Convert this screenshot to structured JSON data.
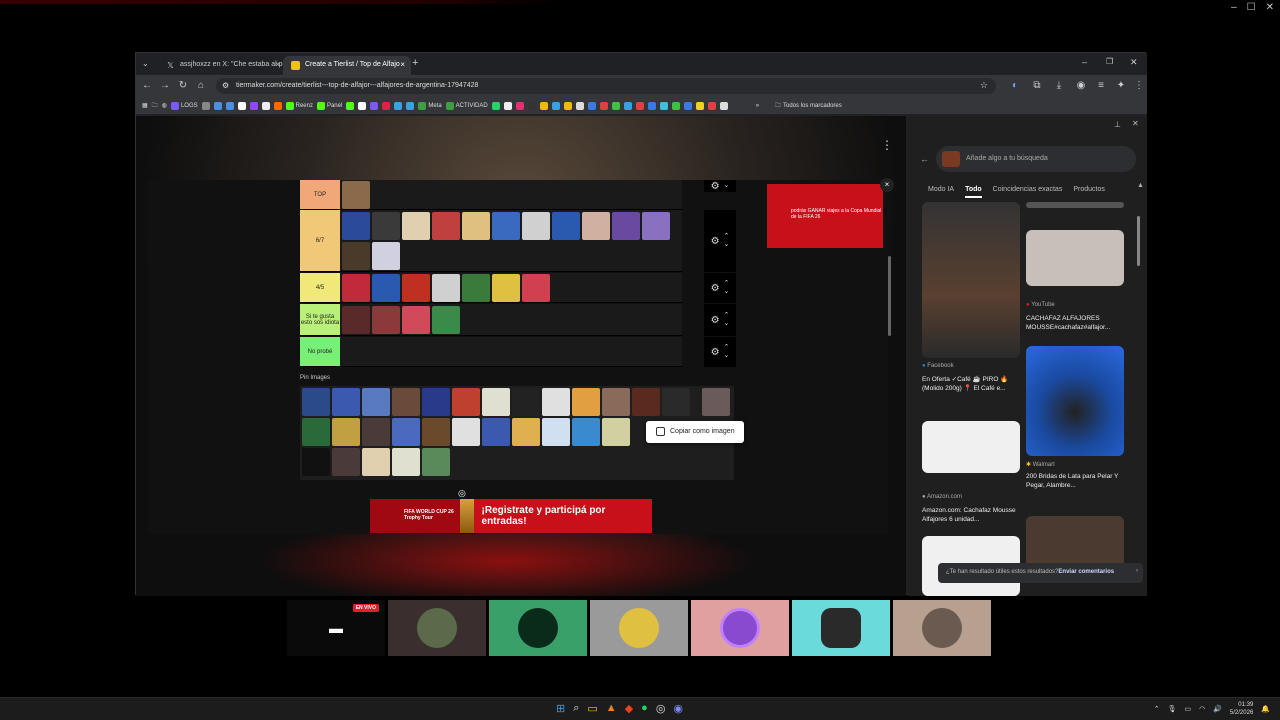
{
  "window": {
    "controls": [
      "–",
      "☐",
      "✕"
    ]
  },
  "browser": {
    "tabs": [
      {
        "icon": "x-logo-icon",
        "label": "assjhoxzz en X: \"Che estaba al p"
      },
      {
        "icon": "tiermaker-icon",
        "label": "Create a Tierlist / Top de Alfajo"
      }
    ],
    "tab_close": "×",
    "new_tab": "+",
    "url": "tiermaker.com/create/tierlist---top-de-alfajor---alfajores-de-argentina-17947428",
    "bookmarks": [
      "LOGS",
      "Reenz",
      "Panel",
      "Meta",
      "ACTIVIDAD"
    ],
    "all_bookmarks": "Todos los marcadores",
    "more": "»"
  },
  "tierlist": {
    "tiers": [
      {
        "label": "TOP",
        "color": "#f0a878"
      },
      {
        "label": "6/7",
        "color": "#f0c878"
      },
      {
        "label": "4/5",
        "color": "#f0e878"
      },
      {
        "label": "Si te gusta esto sos idiota",
        "color": "#b8f078"
      },
      {
        "label": "No probé",
        "color": "#78f078"
      }
    ],
    "pin_label": "Pin Images",
    "context_menu": "Copiar como imagen",
    "banner_text": "¡Registrate y participá por entradas!",
    "banner_left": "FIFA WORLD CUP 26 Trophy Tour",
    "ad_right_text": "podrás GANAR viajes a la Copa Mundial de la FIFA 26",
    "ad_close": "×"
  },
  "side_panel": {
    "search_placeholder": "Añade algo a tu búsqueda",
    "tabs": [
      "Modo IA",
      "Todo",
      "Coincidencias exactas",
      "Productos"
    ],
    "active_tab": "Todo",
    "results": [
      {
        "source": "YouTube",
        "title": "CACHAFAZ ALFAJORES MOUSSE#cachafaz#alfajor..."
      },
      {
        "source": "Facebook",
        "title": "En Oferta ✓Café ☕ PIRO 🔥 (Molido 200g) 📍 El Café e..."
      },
      {
        "source": "Walmart",
        "title": "200 Bridas de Lata para Pelar Y Pegar, Alambre..."
      },
      {
        "source": "Amazon.com",
        "title": "Amazon.com: Cachafaz Mousse Alfajores 6 unidad..."
      }
    ],
    "feedback_q": "¿Te han resultado útiles estos resultados?",
    "feedback_link": "Enviar comentarios"
  },
  "call": {
    "live_badge": "EN VIVO"
  },
  "taskbar": {
    "time": "01:39",
    "date": "5/2/2026"
  }
}
